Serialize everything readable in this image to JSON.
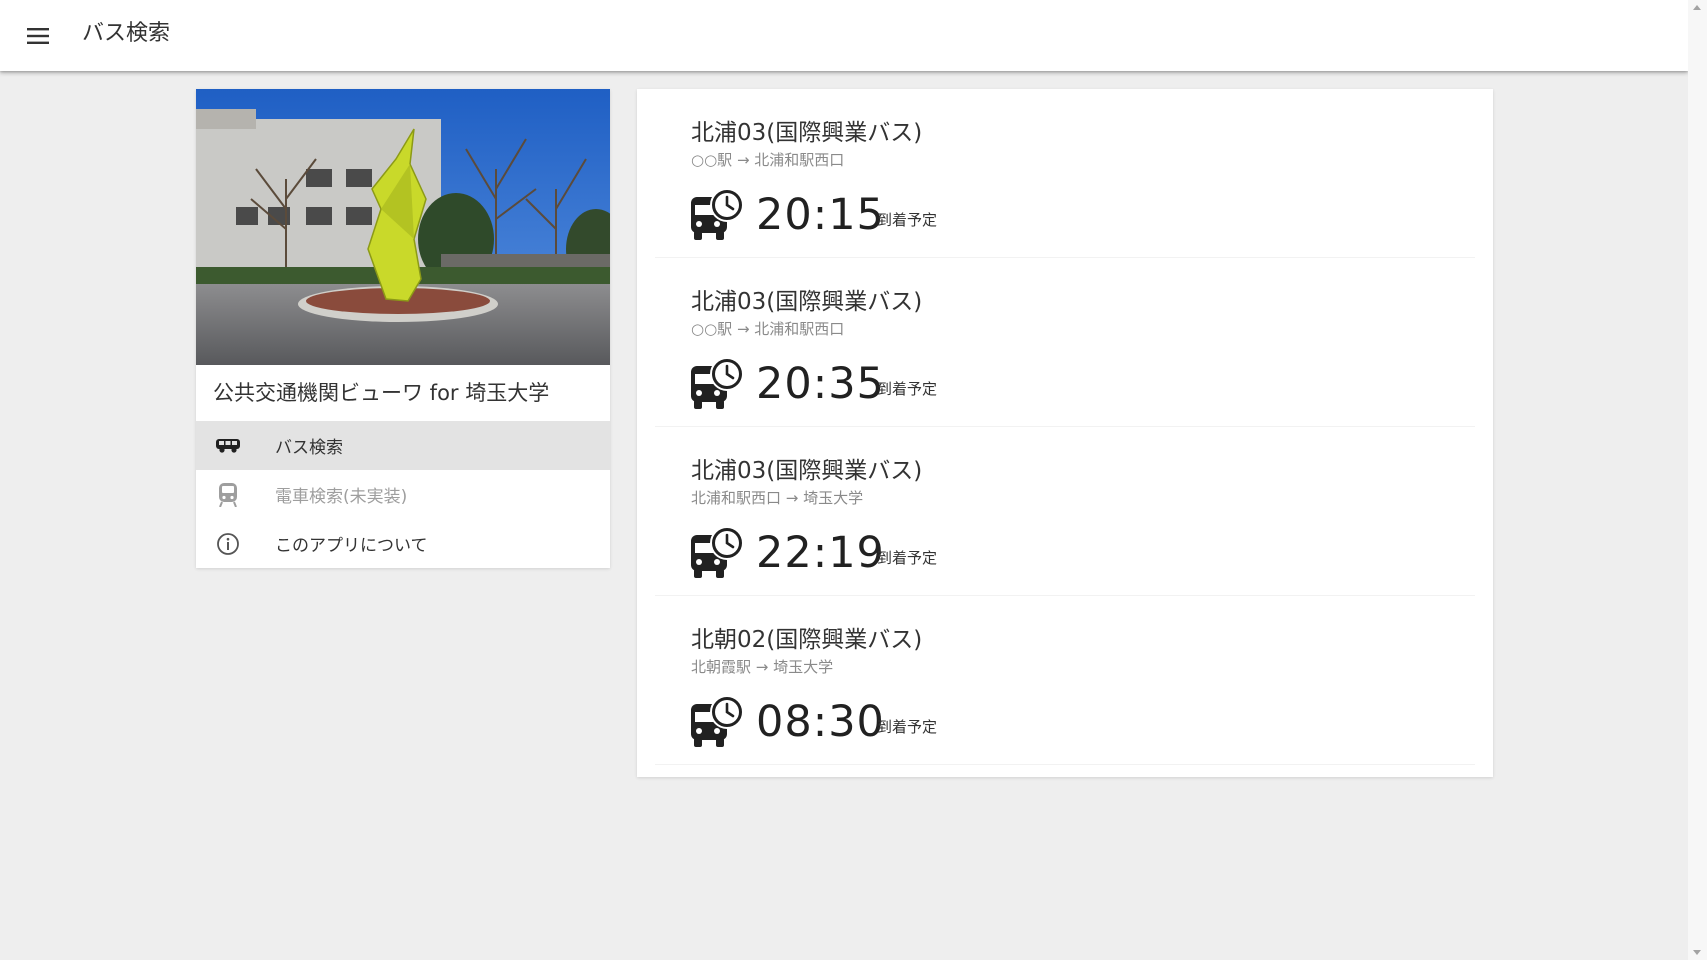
{
  "appbar": {
    "title": "バス検索",
    "menu_icon": "menu-icon"
  },
  "sidebar": {
    "photo_alt": "campus-photo",
    "app_title": "公共交通機関ビューワ for 埼玉大学",
    "items": [
      {
        "label": "バス検索",
        "icon": "bus-icon",
        "active": true,
        "disabled": false
      },
      {
        "label": "電車検索(未実装)",
        "icon": "train-icon",
        "active": false,
        "disabled": true
      },
      {
        "label": "このアプリについて",
        "icon": "info-icon",
        "active": false,
        "disabled": false
      }
    ]
  },
  "results": [
    {
      "name": "北浦03(国際興業バス)",
      "route": "○○駅 → 北浦和駅西口",
      "time": "20:15",
      "suffix": "到着予定"
    },
    {
      "name": "北浦03(国際興業バス)",
      "route": "○○駅 → 北浦和駅西口",
      "time": "20:35",
      "suffix": "到着予定"
    },
    {
      "name": "北浦03(国際興業バス)",
      "route": "北浦和駅西口 → 埼玉大学",
      "time": "22:19",
      "suffix": "到着予定"
    },
    {
      "name": "北朝02(国際興業バス)",
      "route": "北朝霞駅 → 埼玉大学",
      "time": "08:30",
      "suffix": "到着予定"
    }
  ],
  "colors": {
    "background": "#eeeeee",
    "card": "#ffffff",
    "active_nav": "#e3e3e3",
    "icon": "#212121"
  }
}
